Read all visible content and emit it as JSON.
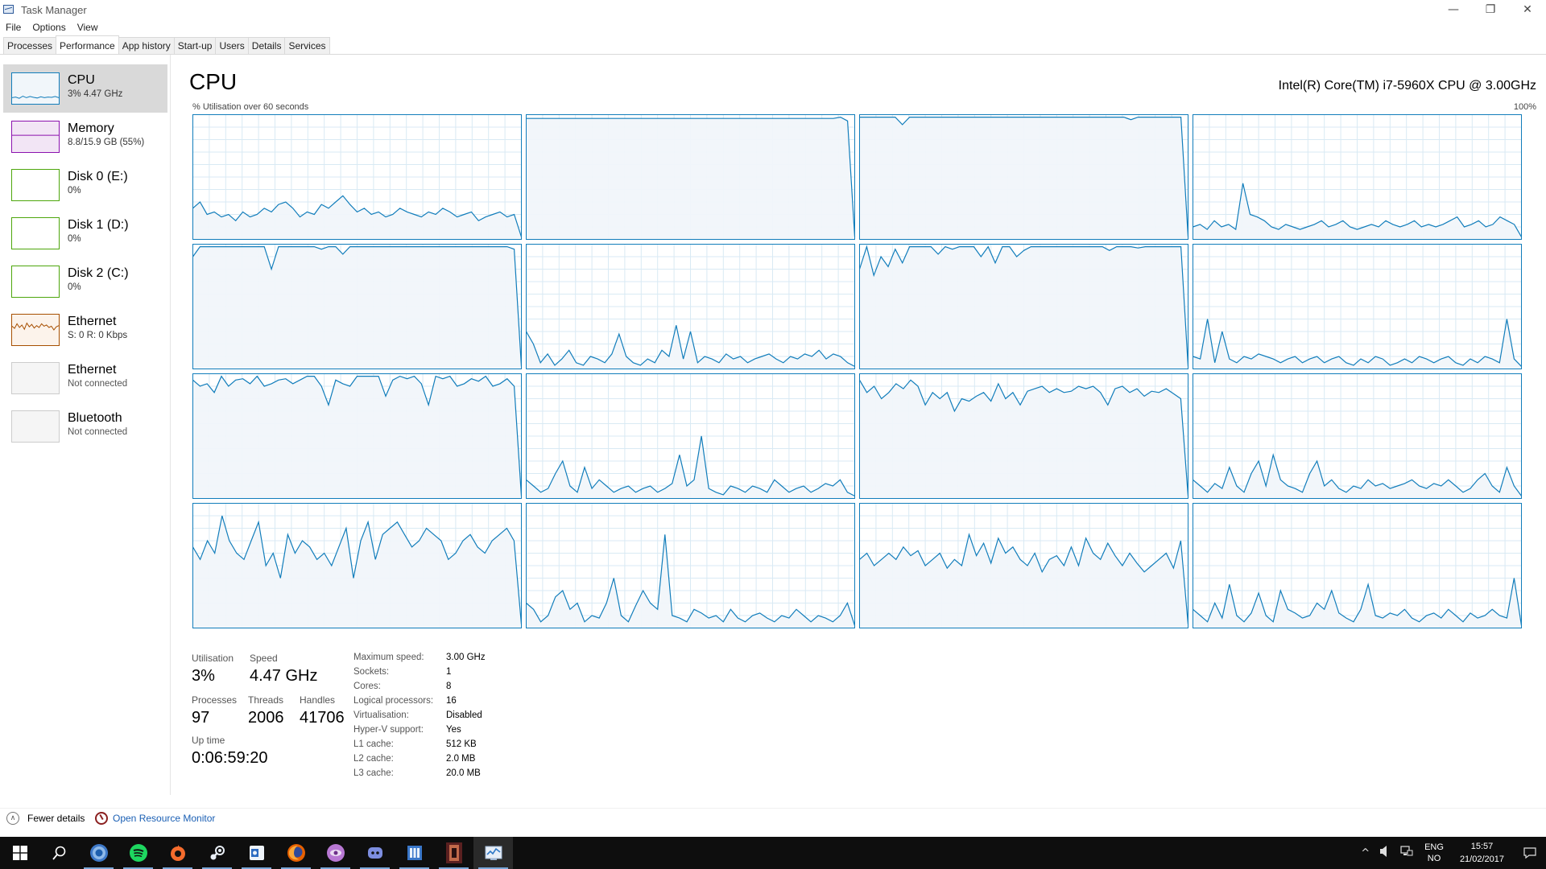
{
  "window": {
    "title": "Task Manager",
    "minimize": "—",
    "restore": "❐",
    "close": "✕"
  },
  "menu": [
    "File",
    "Options",
    "View"
  ],
  "tabs": [
    {
      "label": "Processes",
      "active": false
    },
    {
      "label": "Performance",
      "active": true
    },
    {
      "label": "App history",
      "active": false
    },
    {
      "label": "Start-up",
      "active": false
    },
    {
      "label": "Users",
      "active": false
    },
    {
      "label": "Details",
      "active": false
    },
    {
      "label": "Services",
      "active": false
    }
  ],
  "sidebar": [
    {
      "name": "CPU",
      "sub": "3%  4.47 GHz",
      "color": "#117dbb",
      "fill": "#f1f6fa",
      "spark": [
        20,
        22,
        18,
        25,
        20,
        24,
        21,
        19,
        23,
        20,
        22,
        21,
        24,
        20
      ],
      "active": true
    },
    {
      "name": "Memory",
      "sub": "8.8/15.9 GB (55%)",
      "color": "#8b12ae",
      "fill": "#f2e5f5",
      "level": 0.55
    },
    {
      "name": "Disk 0 (E:)",
      "sub": "0%",
      "color": "#4da60c",
      "fill": "#ffffff"
    },
    {
      "name": "Disk 1 (D:)",
      "sub": "0%",
      "color": "#4da60c",
      "fill": "#ffffff"
    },
    {
      "name": "Disk 2 (C:)",
      "sub": "0%",
      "color": "#4da60c",
      "fill": "#ffffff"
    },
    {
      "name": "Ethernet",
      "sub": "S: 0  R: 0 Kbps",
      "color": "#a74f01",
      "fill": "#fcf3eb",
      "spark": [
        62,
        55,
        70,
        58,
        66,
        52,
        72,
        60,
        68,
        56,
        64,
        58,
        70,
        62,
        66,
        58,
        62,
        50,
        60,
        64
      ]
    },
    {
      "name": "Ethernet",
      "sub": "Not connected",
      "color": "#cccccc",
      "fill": "#f5f5f5",
      "disconnected": true
    },
    {
      "name": "Bluetooth",
      "sub": "Not connected",
      "color": "#cccccc",
      "fill": "#f5f5f5",
      "disconnected": true
    }
  ],
  "main": {
    "title": "CPU",
    "model": "Intel(R) Core(TM) i7-5960X CPU @ 3.00GHz",
    "util_caption": "% Utilisation over 60 seconds",
    "max_caption": "100%",
    "graph_color": "#117dbb",
    "graph_fill": "#f1f6fa",
    "grid_color": "#d9eaf4"
  },
  "chart_data": {
    "type": "line",
    "title": "% Utilisation over 60 seconds",
    "ylim": [
      0,
      100
    ],
    "series": [
      {
        "values": [
          25,
          30,
          20,
          22,
          18,
          20,
          15,
          22,
          18,
          20,
          25,
          22,
          28,
          30,
          25,
          18,
          22,
          20,
          28,
          25,
          30,
          35,
          28,
          22,
          25,
          20,
          22,
          18,
          20,
          25,
          22,
          20,
          18,
          22,
          20,
          25,
          22,
          18,
          20,
          22,
          15,
          18,
          20,
          22,
          18,
          20,
          2
        ]
      },
      {
        "values": [
          97,
          97,
          97,
          97,
          97,
          97,
          97,
          97,
          97,
          97,
          97,
          97,
          97,
          97,
          97,
          97,
          97,
          97,
          97,
          97,
          97,
          97,
          97,
          97,
          97,
          97,
          97,
          97,
          97,
          97,
          97,
          97,
          97,
          97,
          97,
          97,
          97,
          97,
          97,
          97,
          97,
          97,
          97,
          97,
          98,
          95,
          2
        ]
      },
      {
        "values": [
          98,
          98,
          98,
          98,
          98,
          98,
          92,
          98,
          98,
          98,
          98,
          98,
          98,
          98,
          98,
          98,
          98,
          98,
          98,
          98,
          98,
          98,
          98,
          98,
          98,
          98,
          98,
          98,
          98,
          98,
          98,
          98,
          98,
          98,
          98,
          98,
          98,
          98,
          96,
          98,
          98,
          98,
          98,
          98,
          98,
          98,
          2
        ]
      },
      {
        "values": [
          10,
          12,
          8,
          15,
          10,
          12,
          8,
          45,
          20,
          18,
          15,
          10,
          8,
          12,
          10,
          8,
          10,
          12,
          15,
          10,
          12,
          15,
          10,
          8,
          10,
          12,
          10,
          15,
          12,
          10,
          12,
          15,
          10,
          12,
          10,
          12,
          15,
          18,
          10,
          12,
          15,
          10,
          12,
          18,
          15,
          12,
          2
        ]
      },
      {
        "values": [
          90,
          98,
          98,
          98,
          98,
          98,
          98,
          98,
          98,
          98,
          98,
          80,
          98,
          98,
          98,
          98,
          98,
          98,
          96,
          98,
          98,
          92,
          98,
          98,
          98,
          98,
          98,
          98,
          98,
          98,
          98,
          98,
          98,
          98,
          98,
          98,
          98,
          98,
          98,
          98,
          98,
          98,
          98,
          98,
          98,
          96,
          2
        ]
      },
      {
        "values": [
          30,
          20,
          5,
          12,
          3,
          8,
          15,
          5,
          3,
          10,
          8,
          5,
          12,
          28,
          10,
          5,
          3,
          8,
          5,
          15,
          10,
          35,
          8,
          30,
          5,
          10,
          8,
          5,
          12,
          8,
          10,
          5,
          8,
          10,
          12,
          8,
          5,
          10,
          8,
          12,
          10,
          15,
          8,
          12,
          10,
          5,
          2
        ]
      },
      {
        "values": [
          80,
          98,
          75,
          90,
          82,
          96,
          85,
          98,
          98,
          98,
          98,
          92,
          98,
          96,
          98,
          98,
          98,
          90,
          98,
          85,
          98,
          98,
          90,
          95,
          98,
          98,
          98,
          98,
          98,
          98,
          98,
          98,
          98,
          98,
          98,
          95,
          98,
          98,
          98,
          97,
          98,
          98,
          98,
          98,
          98,
          98,
          2
        ]
      },
      {
        "values": [
          10,
          8,
          40,
          5,
          30,
          8,
          5,
          10,
          8,
          12,
          10,
          8,
          5,
          8,
          10,
          5,
          8,
          10,
          5,
          8,
          10,
          5,
          3,
          8,
          5,
          10,
          8,
          3,
          5,
          8,
          5,
          10,
          8,
          5,
          8,
          10,
          5,
          3,
          8,
          5,
          10,
          8,
          5,
          40,
          8,
          2
        ]
      },
      {
        "values": [
          95,
          90,
          92,
          85,
          98,
          90,
          95,
          96,
          92,
          98,
          90,
          92,
          95,
          96,
          92,
          95,
          98,
          98,
          90,
          75,
          95,
          92,
          90,
          98,
          98,
          98,
          98,
          82,
          95,
          98,
          96,
          98,
          92,
          75,
          98,
          96,
          98,
          90,
          92,
          96,
          94,
          98,
          90,
          92,
          96,
          90,
          2
        ]
      },
      {
        "values": [
          15,
          10,
          5,
          8,
          20,
          30,
          10,
          5,
          25,
          8,
          15,
          10,
          5,
          8,
          10,
          5,
          8,
          10,
          5,
          8,
          12,
          35,
          10,
          15,
          50,
          8,
          5,
          3,
          10,
          8,
          5,
          10,
          8,
          5,
          15,
          10,
          5,
          8,
          10,
          5,
          8,
          12,
          10,
          15,
          5,
          2
        ]
      },
      {
        "values": [
          95,
          85,
          90,
          80,
          85,
          92,
          88,
          95,
          90,
          75,
          85,
          80,
          85,
          70,
          80,
          78,
          82,
          85,
          78,
          92,
          80,
          85,
          75,
          86,
          88,
          90,
          85,
          88,
          85,
          86,
          90,
          88,
          90,
          85,
          75,
          88,
          90,
          85,
          88,
          82,
          86,
          85,
          88,
          84,
          80,
          2
        ]
      },
      {
        "values": [
          15,
          10,
          5,
          12,
          8,
          25,
          10,
          5,
          20,
          30,
          10,
          35,
          15,
          10,
          8,
          5,
          20,
          30,
          10,
          15,
          8,
          5,
          10,
          8,
          15,
          10,
          12,
          8,
          10,
          12,
          15,
          10,
          8,
          12,
          10,
          15,
          10,
          5,
          8,
          15,
          20,
          10,
          5,
          25,
          10,
          2
        ]
      },
      {
        "values": [
          65,
          55,
          70,
          60,
          90,
          70,
          60,
          55,
          70,
          85,
          50,
          60,
          40,
          75,
          60,
          70,
          65,
          55,
          60,
          50,
          65,
          80,
          40,
          70,
          85,
          55,
          75,
          80,
          85,
          75,
          65,
          70,
          80,
          75,
          70,
          55,
          60,
          70,
          75,
          65,
          60,
          70,
          75,
          80,
          70,
          3
        ]
      },
      {
        "values": [
          20,
          15,
          5,
          10,
          25,
          30,
          15,
          20,
          5,
          10,
          8,
          20,
          40,
          10,
          5,
          18,
          30,
          20,
          15,
          75,
          10,
          8,
          5,
          15,
          12,
          8,
          10,
          5,
          15,
          8,
          5,
          10,
          12,
          8,
          5,
          10,
          8,
          15,
          10,
          5,
          10,
          8,
          5,
          10,
          20,
          2
        ]
      },
      {
        "values": [
          55,
          60,
          50,
          55,
          60,
          55,
          65,
          58,
          62,
          50,
          55,
          60,
          48,
          55,
          50,
          75,
          58,
          68,
          52,
          72,
          60,
          65,
          55,
          50,
          60,
          45,
          55,
          58,
          50,
          65,
          50,
          72,
          60,
          55,
          68,
          58,
          50,
          60,
          52,
          45,
          50,
          55,
          60,
          48,
          70,
          3
        ]
      },
      {
        "values": [
          15,
          10,
          5,
          20,
          8,
          35,
          10,
          5,
          12,
          28,
          10,
          5,
          30,
          15,
          12,
          8,
          10,
          20,
          15,
          30,
          12,
          8,
          5,
          15,
          35,
          10,
          8,
          12,
          10,
          15,
          8,
          5,
          10,
          12,
          8,
          15,
          10,
          5,
          12,
          8,
          10,
          15,
          10,
          8,
          40,
          2
        ]
      }
    ]
  },
  "stats": {
    "utilisation_label": "Utilisation",
    "utilisation": "3%",
    "speed_label": "Speed",
    "speed": "4.47 GHz",
    "processes_label": "Processes",
    "processes": "97",
    "threads_label": "Threads",
    "threads": "2006",
    "handles_label": "Handles",
    "handles": "41706",
    "uptime_label": "Up time",
    "uptime": "0:06:59:20"
  },
  "specs": [
    {
      "label": "Maximum speed:",
      "value": "3.00 GHz"
    },
    {
      "label": "Sockets:",
      "value": "1"
    },
    {
      "label": "Cores:",
      "value": "8"
    },
    {
      "label": "Logical processors:",
      "value": "16"
    },
    {
      "label": "Virtualisation:",
      "value": "Disabled"
    },
    {
      "label": "Hyper-V support:",
      "value": "Yes"
    },
    {
      "label": "L1 cache:",
      "value": "512 KB"
    },
    {
      "label": "L2 cache:",
      "value": "2.0 MB"
    },
    {
      "label": "L3 cache:",
      "value": "20.0 MB"
    }
  ],
  "footer": {
    "fewer": "Fewer details",
    "resmon": "Open Resource Monitor"
  },
  "taskbar": {
    "apps": [
      "start-icon",
      "search-icon",
      "chrome-icon",
      "spotify-icon",
      "origin-icon",
      "steam-icon",
      "outlook-icon",
      "firefox-icon",
      "browser-icon",
      "discord-icon",
      "calculator-icon",
      "game-icon",
      "task-manager-icon"
    ],
    "tray_chevron": "^",
    "lang_top": "ENG",
    "lang_bottom": "NO",
    "time": "15:57",
    "date": "21/02/2017"
  }
}
